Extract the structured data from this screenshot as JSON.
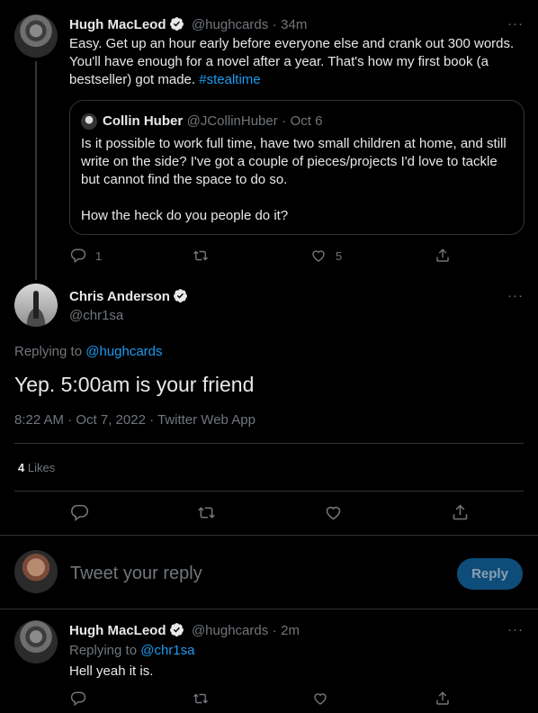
{
  "tweet1": {
    "author_name": "Hugh MacLeod",
    "author_handle": "@hughcards",
    "time_sep": "·",
    "time": "34m",
    "text_line1": "Easy. Get up an hour early before everyone else and crank out 300 words.",
    "text_line2": "You'll have enough for a novel after a year. That's how my first book (a",
    "text_line3a": "bestseller) got made. ",
    "hashtag": "#stealtime",
    "reply_count": "1",
    "retweet_count": "",
    "like_count": "5"
  },
  "quoted": {
    "author_name": "Collin Huber",
    "author_handle": "@JCollinHuber",
    "time_sep": "·",
    "time": "Oct 6",
    "line1": "Is it possible to work full time, have two small children at home, and still",
    "line2": "write on the side? I've got a couple of pieces/projects I'd love to tackle",
    "line3": "but cannot find the space to do so.",
    "line4": "How the heck do you people do it?"
  },
  "main": {
    "author_name": "Chris Anderson",
    "author_handle": "@chr1sa",
    "replying_to_label": "Replying to ",
    "replying_to_handle": "@hughcards",
    "text": "Yep. 5:00am is your friend",
    "meta": "8:22 AM · Oct 7, 2022 · Twitter Web App",
    "likes_count": "4",
    "likes_label": "Likes"
  },
  "composer": {
    "placeholder": "Tweet your reply",
    "button_label": "Reply"
  },
  "reply": {
    "author_name": "Hugh MacLeod",
    "author_handle": "@hughcards",
    "time_sep": "·",
    "time": "2m",
    "replying_to_label": "Replying to ",
    "replying_to_handle": "@chr1sa",
    "text": "Hell yeah it is."
  },
  "more_glyph": "···",
  "colors": {
    "background": "#000000",
    "text": "#e7e9ea",
    "muted": "#71767b",
    "accent": "#1d9bf0",
    "border": "#2f3336"
  },
  "icons": [
    "verified-icon",
    "more-icon",
    "reply-icon",
    "retweet-icon",
    "like-icon",
    "share-icon"
  ]
}
